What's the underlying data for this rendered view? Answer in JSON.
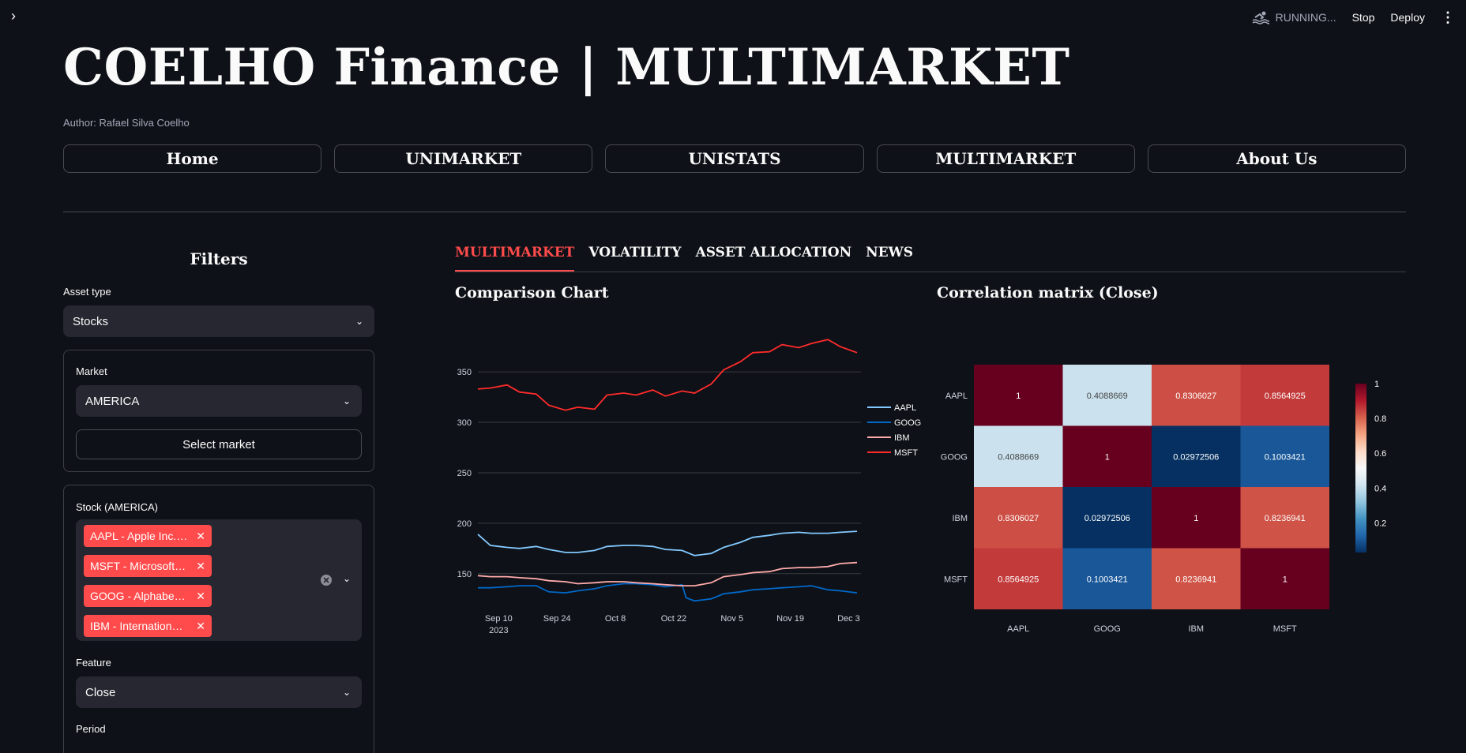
{
  "header": {
    "status_text": "RUNNING...",
    "stop_label": "Stop",
    "deploy_label": "Deploy"
  },
  "title": "COELHO Finance | MULTIMARKET",
  "author": "Author: Rafael Silva Coelho",
  "nav": {
    "home": "Home",
    "unimarket": "UNIMARKET",
    "unistats": "UNISTATS",
    "multimarket": "MULTIMARKET",
    "about": "About Us"
  },
  "filters": {
    "title": "Filters",
    "asset_type_label": "Asset type",
    "asset_type_value": "Stocks",
    "market_label": "Market",
    "market_value": "AMERICA",
    "select_market_label": "Select market",
    "stock_label": "Stock (AMERICA)",
    "stocks": [
      "AAPL - Apple Inc.…",
      "MSFT - Microsoft…",
      "GOOG - Alphabe…",
      "IBM - Internation…"
    ],
    "feature_label": "Feature",
    "feature_value": "Close",
    "period_label": "Period"
  },
  "tabs": [
    "MULTIMARKET",
    "VOLATILITY",
    "ASSET ALLOCATION",
    "NEWS"
  ],
  "comparison_title": "Comparison Chart",
  "correlation_title": "Correlation matrix (Close)",
  "colors": {
    "accent": "#ff4b4b",
    "background": "#0e1117",
    "widget": "#262730"
  },
  "chart_data": [
    {
      "type": "line",
      "title": "Comparison Chart",
      "x_ticks": [
        "Sep 10\n2023",
        "Sep 24",
        "Oct 8",
        "Oct 22",
        "Nov 5",
        "Nov 19",
        "Dec 3"
      ],
      "y_ticks": [
        150,
        200,
        250,
        300,
        350
      ],
      "ylim": [
        124,
        390
      ],
      "x_range_days": [
        "2023-09-05",
        "2023-12-05"
      ],
      "grid": true,
      "legend_position": "right",
      "series": [
        {
          "name": "AAPL",
          "color": "#83c9ff",
          "x": [
            "2023-09-05",
            "2023-09-08",
            "2023-09-12",
            "2023-09-15",
            "2023-09-19",
            "2023-09-22",
            "2023-09-26",
            "2023-09-29",
            "2023-10-03",
            "2023-10-06",
            "2023-10-10",
            "2023-10-13",
            "2023-10-17",
            "2023-10-20",
            "2023-10-24",
            "2023-10-27",
            "2023-10-31",
            "2023-11-03",
            "2023-11-07",
            "2023-11-10",
            "2023-11-14",
            "2023-11-17",
            "2023-11-21",
            "2023-11-24",
            "2023-11-28",
            "2023-12-01",
            "2023-12-05"
          ],
          "values": [
            189,
            178,
            176,
            175,
            177,
            174,
            171,
            171,
            173,
            177,
            178,
            178,
            177,
            174,
            173,
            168,
            170,
            176,
            181,
            186,
            188,
            190,
            191,
            190,
            190,
            191,
            192
          ]
        },
        {
          "name": "GOOG",
          "color": "#0068c9",
          "x": [
            "2023-09-05",
            "2023-09-08",
            "2023-09-12",
            "2023-09-15",
            "2023-09-19",
            "2023-09-22",
            "2023-09-26",
            "2023-09-29",
            "2023-10-03",
            "2023-10-06",
            "2023-10-10",
            "2023-10-13",
            "2023-10-17",
            "2023-10-20",
            "2023-10-24",
            "2023-10-25",
            "2023-10-27",
            "2023-10-31",
            "2023-11-03",
            "2023-11-07",
            "2023-11-10",
            "2023-11-14",
            "2023-11-17",
            "2023-11-21",
            "2023-11-24",
            "2023-11-28",
            "2023-12-01",
            "2023-12-05"
          ],
          "values": [
            136,
            136,
            137,
            138,
            138,
            132,
            131,
            133,
            135,
            138,
            140,
            140,
            139,
            137,
            139,
            126,
            123,
            125,
            130,
            132,
            134,
            135,
            136,
            137,
            138,
            134,
            133,
            131
          ]
        },
        {
          "name": "IBM",
          "color": "#ffabab",
          "x": [
            "2023-09-05",
            "2023-09-08",
            "2023-09-12",
            "2023-09-15",
            "2023-09-19",
            "2023-09-22",
            "2023-09-26",
            "2023-09-29",
            "2023-10-03",
            "2023-10-06",
            "2023-10-10",
            "2023-10-13",
            "2023-10-17",
            "2023-10-20",
            "2023-10-24",
            "2023-10-27",
            "2023-10-31",
            "2023-11-03",
            "2023-11-07",
            "2023-11-10",
            "2023-11-14",
            "2023-11-17",
            "2023-11-21",
            "2023-11-24",
            "2023-11-28",
            "2023-12-01",
            "2023-12-05"
          ],
          "values": [
            148,
            147,
            147,
            146,
            145,
            143,
            142,
            140,
            141,
            142,
            142,
            141,
            140,
            139,
            138,
            138,
            141,
            147,
            149,
            151,
            152,
            155,
            156,
            156,
            157,
            160,
            161
          ]
        },
        {
          "name": "MSFT",
          "color": "#ff2b2b",
          "x": [
            "2023-09-05",
            "2023-09-08",
            "2023-09-12",
            "2023-09-15",
            "2023-09-19",
            "2023-09-22",
            "2023-09-26",
            "2023-09-29",
            "2023-10-03",
            "2023-10-06",
            "2023-10-10",
            "2023-10-13",
            "2023-10-17",
            "2023-10-20",
            "2023-10-24",
            "2023-10-27",
            "2023-10-31",
            "2023-11-03",
            "2023-11-07",
            "2023-11-10",
            "2023-11-14",
            "2023-11-17",
            "2023-11-21",
            "2023-11-24",
            "2023-11-28",
            "2023-12-01",
            "2023-12-05"
          ],
          "values": [
            333,
            334,
            337,
            330,
            328,
            317,
            312,
            315,
            313,
            327,
            329,
            327,
            332,
            326,
            331,
            329,
            338,
            352,
            360,
            369,
            370,
            377,
            374,
            378,
            382,
            375,
            369
          ]
        }
      ]
    },
    {
      "type": "heatmap",
      "title": "Correlation matrix (Close)",
      "x_labels": [
        "AAPL",
        "GOOG",
        "IBM",
        "MSFT"
      ],
      "y_labels": [
        "AAPL",
        "GOOG",
        "IBM",
        "MSFT"
      ],
      "values": [
        [
          1,
          0.4088669,
          0.8306027,
          0.8564925
        ],
        [
          0.4088669,
          1,
          0.02972506,
          0.1003421
        ],
        [
          0.8306027,
          0.02972506,
          1,
          0.8236941
        ],
        [
          0.8564925,
          0.1003421,
          0.8236941,
          1
        ]
      ],
      "value_labels": [
        [
          "1",
          "0.4088669",
          "0.8306027",
          "0.8564925"
        ],
        [
          "0.4088669",
          "1",
          "0.02972506",
          "0.1003421"
        ],
        [
          "0.8306027",
          "0.02972506",
          "1",
          "0.8236941"
        ],
        [
          "0.8564925",
          "0.1003421",
          "0.8236941",
          "1"
        ]
      ],
      "colorscale": "RdBu",
      "colorbar_ticks": [
        0.2,
        0.4,
        0.6,
        0.8,
        1
      ],
      "colorbar_tick_labels": [
        "0.2",
        "0.4",
        "0.6",
        "0.8",
        "1"
      ],
      "zlim": [
        0.02972506,
        1
      ]
    }
  ]
}
